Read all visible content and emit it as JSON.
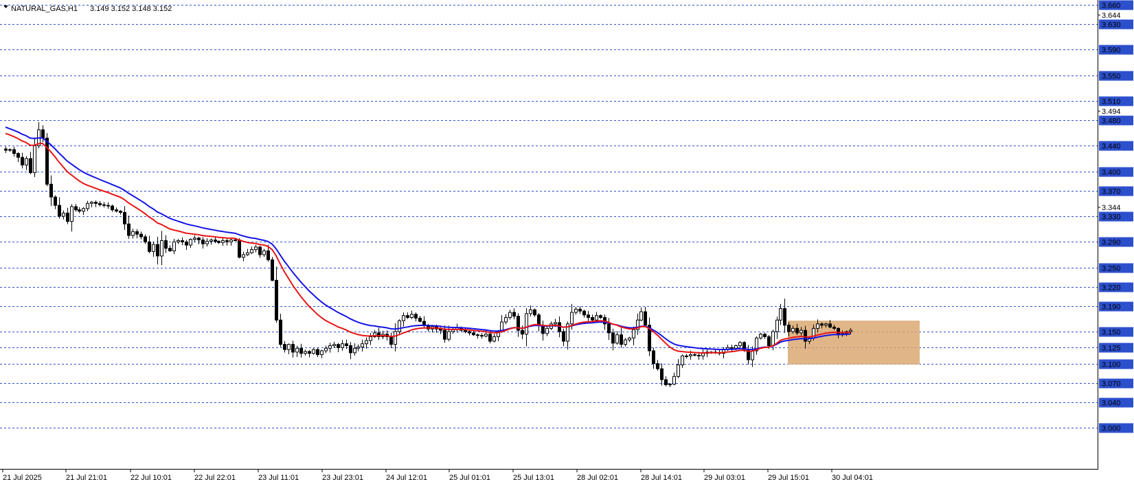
{
  "header": {
    "symbol": "NATURAL_GAS,H1",
    "ohlc": "3.149 3.152 3.148 3.152"
  },
  "colors": {
    "background": "#ffffff",
    "grid_line": "#2c4fcc",
    "candle": "#000000",
    "ma_fast": "#e81414",
    "ma_slow": "#1414e6",
    "highlight_box": "#d9a66e",
    "price_tag_bg": "#2c4fcc",
    "price_tag_text": "#ffffff"
  },
  "chart_data": {
    "type": "candlestick",
    "ylim": [
      2.992,
      3.665
    ],
    "grid": true,
    "price_levels": [
      "3.660",
      "3.630",
      "3.590",
      "3.550",
      "3.510",
      "3.480",
      "3.440",
      "3.400",
      "3.370",
      "3.330",
      "3.290",
      "3.250",
      "3.220",
      "3.190",
      "3.150",
      "3.125",
      "3.100",
      "3.070",
      "3.040",
      "3.000"
    ],
    "axis_ticks": [
      "3.644",
      "3.494",
      "3.344"
    ],
    "x_labels": [
      "21 Jul 2025",
      "21 Jul 21:01",
      "22 Jul 10:01",
      "22 Jul 22:01",
      "23 Jul 11:01",
      "23 Jul 23:01",
      "24 Jul 12:01",
      "25 Jul 01:01",
      "25 Jul 13:01",
      "28 Jul 02:01",
      "28 Jul 14:01",
      "29 Jul 03:01",
      "29 Jul 15:01",
      "30 Jul 04:01"
    ],
    "candles_close": [
      3.433,
      3.434,
      3.428,
      3.422,
      3.41,
      3.42,
      3.398,
      3.44,
      3.465,
      3.452,
      3.38,
      3.36,
      3.347,
      3.33,
      3.335,
      3.322,
      3.345,
      3.34,
      3.338,
      3.342,
      3.35,
      3.352,
      3.35,
      3.348,
      3.347,
      3.346,
      3.34,
      3.338,
      3.336,
      3.318,
      3.3,
      3.306,
      3.302,
      3.298,
      3.29,
      3.275,
      3.286,
      3.268,
      3.292,
      3.28,
      3.276,
      3.29,
      3.292,
      3.29,
      3.285,
      3.294,
      3.296,
      3.293,
      3.287,
      3.291,
      3.293,
      3.291,
      3.289,
      3.292,
      3.29,
      3.293,
      3.293,
      3.266,
      3.27,
      3.273,
      3.278,
      3.282,
      3.27,
      3.276,
      3.262,
      3.23,
      3.168,
      3.13,
      3.122,
      3.13,
      3.118,
      3.124,
      3.116,
      3.119,
      3.116,
      3.122,
      3.114,
      3.12,
      3.124,
      3.128,
      3.13,
      3.125,
      3.131,
      3.128,
      3.117,
      3.124,
      3.126,
      3.131,
      3.136,
      3.142,
      3.148,
      3.142,
      3.146,
      3.142,
      3.13,
      3.15,
      3.167,
      3.175,
      3.172,
      3.177,
      3.171,
      3.166,
      3.16,
      3.154,
      3.158,
      3.154,
      3.152,
      3.138,
      3.15,
      3.153,
      3.156,
      3.152,
      3.15,
      3.148,
      3.145,
      3.144,
      3.143,
      3.146,
      3.135,
      3.142,
      3.15,
      3.165,
      3.172,
      3.18,
      3.174,
      3.152,
      3.146,
      3.178,
      3.184,
      3.176,
      3.16,
      3.147,
      3.155,
      3.162,
      3.164,
      3.15,
      3.135,
      3.162,
      3.18,
      3.185,
      3.182,
      3.176,
      3.172,
      3.168,
      3.175,
      3.172,
      3.162,
      3.148,
      3.132,
      3.145,
      3.13,
      3.137,
      3.14,
      3.153,
      3.168,
      3.181,
      3.16,
      3.12,
      3.1,
      3.092,
      3.075,
      3.067,
      3.068,
      3.08,
      3.098,
      3.112,
      3.112,
      3.114,
      3.113,
      3.112,
      3.116,
      3.118,
      3.118,
      3.117,
      3.116,
      3.122,
      3.125,
      3.124,
      3.128,
      3.133,
      3.122,
      3.106,
      3.12,
      3.14,
      3.146,
      3.142,
      3.128,
      3.15,
      3.168,
      3.186,
      3.16,
      3.15,
      3.155,
      3.148,
      3.152,
      3.135,
      3.14,
      3.155,
      3.162,
      3.16,
      3.162,
      3.157,
      3.155,
      3.145,
      3.147,
      3.15,
      3.152
    ]
  }
}
